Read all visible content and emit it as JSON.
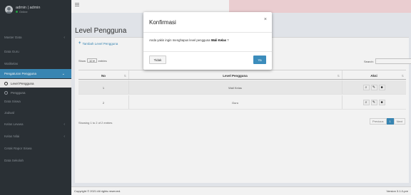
{
  "user": {
    "name": "admin | admin",
    "status": "Online"
  },
  "sidebar": {
    "items": [
      {
        "label": "Master Data",
        "has_caret": true
      },
      {
        "label": "Data Guru",
        "has_caret": false
      },
      {
        "label": "Walikelas",
        "has_caret": false
      },
      {
        "label": "Pengaturan Pengguna",
        "has_caret": true
      },
      {
        "label": "Data Siswa",
        "has_caret": false
      },
      {
        "label": "Jadwal",
        "has_caret": false
      },
      {
        "label": "Kelas Lewwa",
        "has_caret": true
      },
      {
        "label": "Kelas Nilai",
        "has_caret": true
      },
      {
        "label": "Cetak Rapor Siswa",
        "has_caret": false
      },
      {
        "label": "Data Sekolah",
        "has_caret": false
      }
    ],
    "subitems": [
      {
        "label": "Level Pengguna"
      },
      {
        "label": "Pengguna"
      }
    ]
  },
  "topbar": {
    "right_text": "Pelayan"
  },
  "page": {
    "title": "Level Pengguna",
    "add_label": "Tambah Level Pengguna",
    "show_label": "Show",
    "entries_value": "10",
    "entries_label": "entries",
    "search_label": "Search:"
  },
  "table": {
    "headers": [
      "No",
      "Level Pengguna",
      "Aksi"
    ],
    "rows": [
      {
        "no": "1",
        "level": "Wali Kelas"
      },
      {
        "no": "2",
        "level": "Guru"
      }
    ],
    "showing": "Showing 1 to 2 of 2 entries",
    "pager": {
      "previous": "Previous",
      "current": "1",
      "next": "Next"
    }
  },
  "footer": {
    "left": "Copyright © 2021 All rights reserved.",
    "right": "Version 3.1.0-pre"
  },
  "modal": {
    "title": "Konfirmasi",
    "close": "×",
    "body_prefix": "Anda yakin ingin menghapus level pengguna ",
    "body_bold": "Wali Kelas",
    "body_suffix": " ?",
    "no_label": "Tidak",
    "yes_label": "Ya"
  },
  "colors": {
    "accent": "#3c8dbc",
    "sidebar_bg": "#2d3338",
    "pink_bar": "#f7d9dc"
  }
}
